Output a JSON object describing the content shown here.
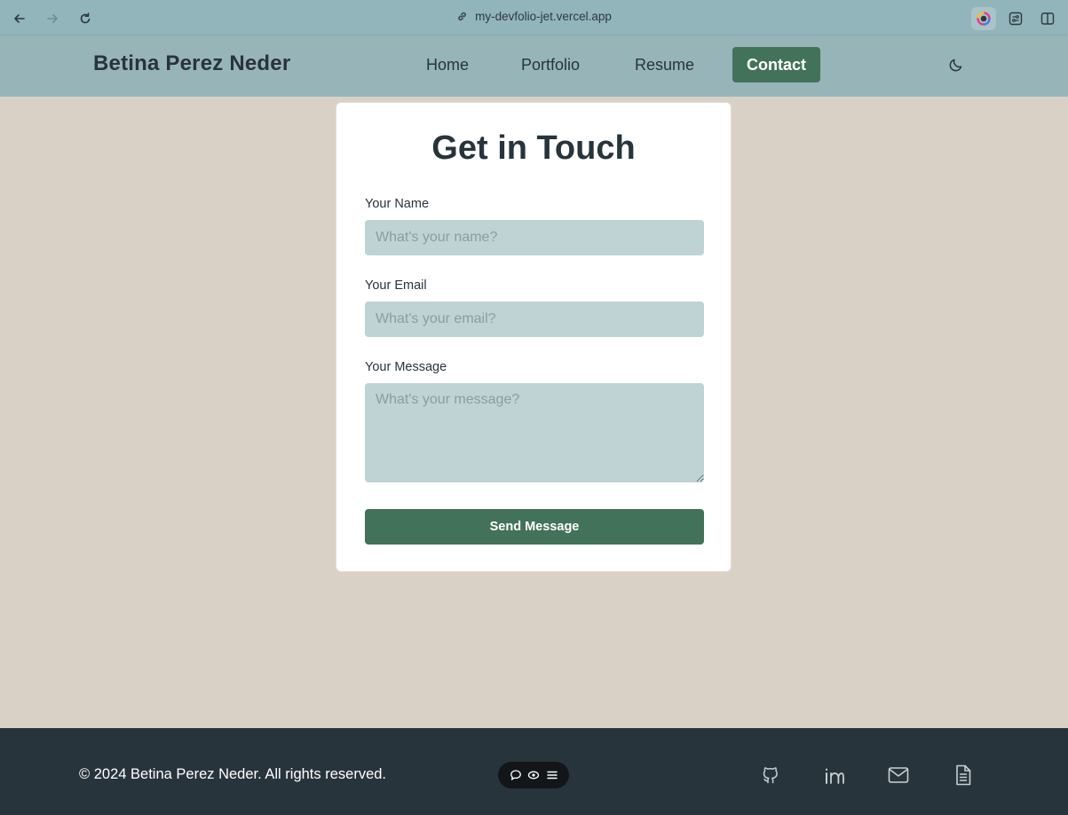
{
  "browser": {
    "url": "my-devfolio-jet.vercel.app",
    "icons": [
      "back-arrow-icon",
      "forward-arrow-icon",
      "reload-icon",
      "link-icon",
      "color-picker-extension-icon",
      "extensions-icon",
      "sidebar-icon"
    ]
  },
  "header": {
    "brand": "Betina Perez Neder",
    "nav": [
      "Home",
      "Portfolio",
      "Resume",
      "Contact"
    ],
    "active_nav": "Contact",
    "theme_icon": "moon-icon"
  },
  "form": {
    "title": "Get in Touch",
    "name_label": "Your Name",
    "name_placeholder": "What's your name?",
    "email_label": "Your Email",
    "email_placeholder": "What's your email?",
    "message_label": "Your Message",
    "message_placeholder": "What's your message?",
    "submit_label": "Send Message"
  },
  "footer": {
    "copyright": "© 2024 Betina Perez Neder. All rights reserved.",
    "toolbar_icons": [
      "chat-icon",
      "eye-icon",
      "menu-icon"
    ],
    "social_icons": [
      "github-icon",
      "linkedin-icon",
      "mail-icon",
      "document-icon"
    ]
  },
  "colors": {
    "browser_bar": "#92b4bb",
    "header": "#97b4b9",
    "page_background": "#d9d1c5",
    "accent_green": "#43725a",
    "input_background": "#bfd3d5",
    "footer": "#28343b",
    "text_dark": "#28343b"
  }
}
